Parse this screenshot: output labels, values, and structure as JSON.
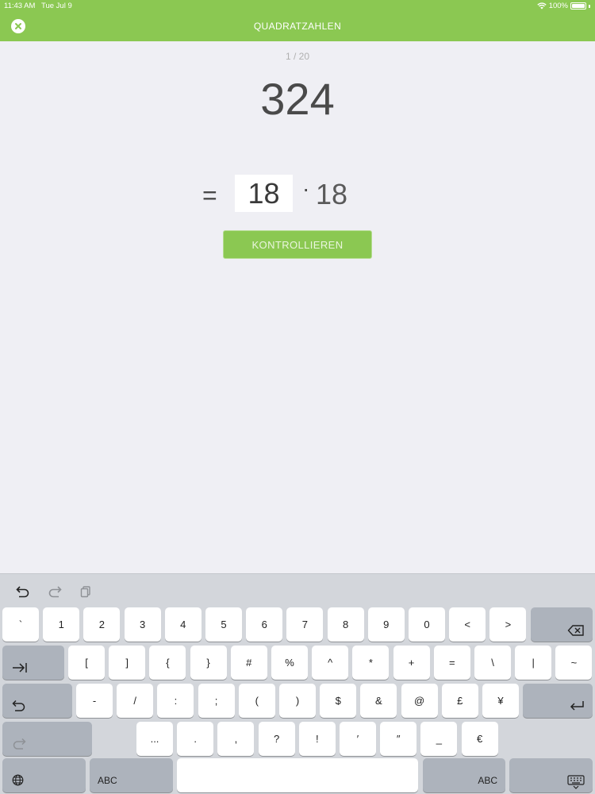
{
  "status_bar": {
    "time": "11:43 AM",
    "date": "Tue Jul 9",
    "battery": "100%"
  },
  "nav": {
    "title": "QUADRATZAHLEN"
  },
  "quiz": {
    "progress": "1 / 20",
    "number": "324",
    "equals": "=",
    "answer": "18",
    "times": "·",
    "factor": "18",
    "check_label": "KONTROLLIEREN"
  },
  "keyboard": {
    "toolbar_icons": [
      "undo-icon",
      "redo-icon",
      "paste-icon"
    ],
    "row1": [
      "`",
      "1",
      "2",
      "3",
      "4",
      "5",
      "6",
      "7",
      "8",
      "9",
      "0",
      "<",
      ">"
    ],
    "row2": [
      "[",
      "]",
      "{",
      "}",
      "#",
      "%",
      "^",
      "*",
      "+",
      "=",
      "\\",
      "|",
      "~"
    ],
    "row3": [
      "-",
      "/",
      ":",
      ";",
      "(",
      ")",
      "$",
      "&",
      "@",
      "£",
      "¥"
    ],
    "row4": [
      "...",
      ".",
      ",",
      "?",
      "!",
      "′",
      "″",
      "_",
      "€"
    ],
    "abc_left": "ABC",
    "abc_right": "ABC"
  }
}
